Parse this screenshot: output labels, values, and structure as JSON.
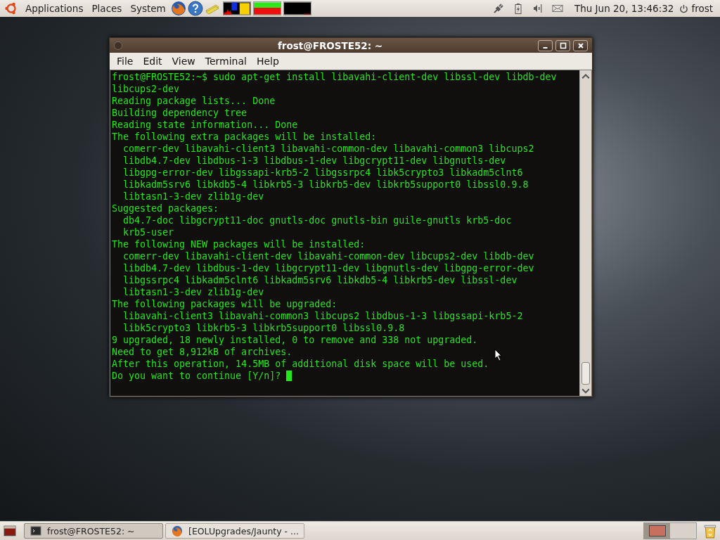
{
  "top_panel": {
    "menus": [
      "Applications",
      "Places",
      "System"
    ],
    "clock": "Thu Jun 20, 13:46:32",
    "user": "frost"
  },
  "window": {
    "title": "frost@FROSTE52: ~",
    "menu": [
      "File",
      "Edit",
      "View",
      "Terminal",
      "Help"
    ],
    "lines": [
      "frost@FROSTE52:~$ sudo apt-get install libavahi-client-dev libssl-dev libdb-dev",
      "libcups2-dev",
      "Reading package lists... Done",
      "Building dependency tree",
      "Reading state information... Done",
      "The following extra packages will be installed:",
      "  comerr-dev libavahi-client3 libavahi-common-dev libavahi-common3 libcups2",
      "  libdb4.7-dev libdbus-1-3 libdbus-1-dev libgcrypt11-dev libgnutls-dev",
      "  libgpg-error-dev libgssapi-krb5-2 libgssrpc4 libk5crypto3 libkadm5clnt6",
      "  libkadm5srv6 libkdb5-4 libkrb5-3 libkrb5-dev libkrb5support0 libssl0.9.8",
      "  libtasn1-3-dev zlib1g-dev",
      "Suggested packages:",
      "  db4.7-doc libgcrypt11-doc gnutls-doc gnutls-bin guile-gnutls krb5-doc",
      "  krb5-user",
      "The following NEW packages will be installed:",
      "  comerr-dev libavahi-client-dev libavahi-common-dev libcups2-dev libdb-dev",
      "  libdb4.7-dev libdbus-1-dev libgcrypt11-dev libgnutls-dev libgpg-error-dev",
      "  libgssrpc4 libkadm5clnt6 libkadm5srv6 libkdb5-4 libkrb5-dev libssl-dev",
      "  libtasn1-3-dev zlib1g-dev",
      "The following packages will be upgraded:",
      "  libavahi-client3 libavahi-common3 libcups2 libdbus-1-3 libgssapi-krb5-2",
      "  libk5crypto3 libkrb5-3 libkrb5support0 libssl0.9.8",
      "9 upgraded, 18 newly installed, 0 to remove and 338 not upgraded.",
      "Need to get 8,912kB of archives.",
      "After this operation, 14.5MB of additional disk space will be used.",
      "Do you want to continue [Y/n]?"
    ]
  },
  "taskbar": {
    "tasks": [
      {
        "kind": "terminal",
        "label": "frost@FROSTE52: ~",
        "selected": true
      },
      {
        "kind": "browser",
        "label": "[EOLUpgrades/Jaunty - ...",
        "selected": false
      }
    ],
    "workspaces": [
      {
        "selected": true
      },
      {
        "selected": false
      }
    ]
  }
}
